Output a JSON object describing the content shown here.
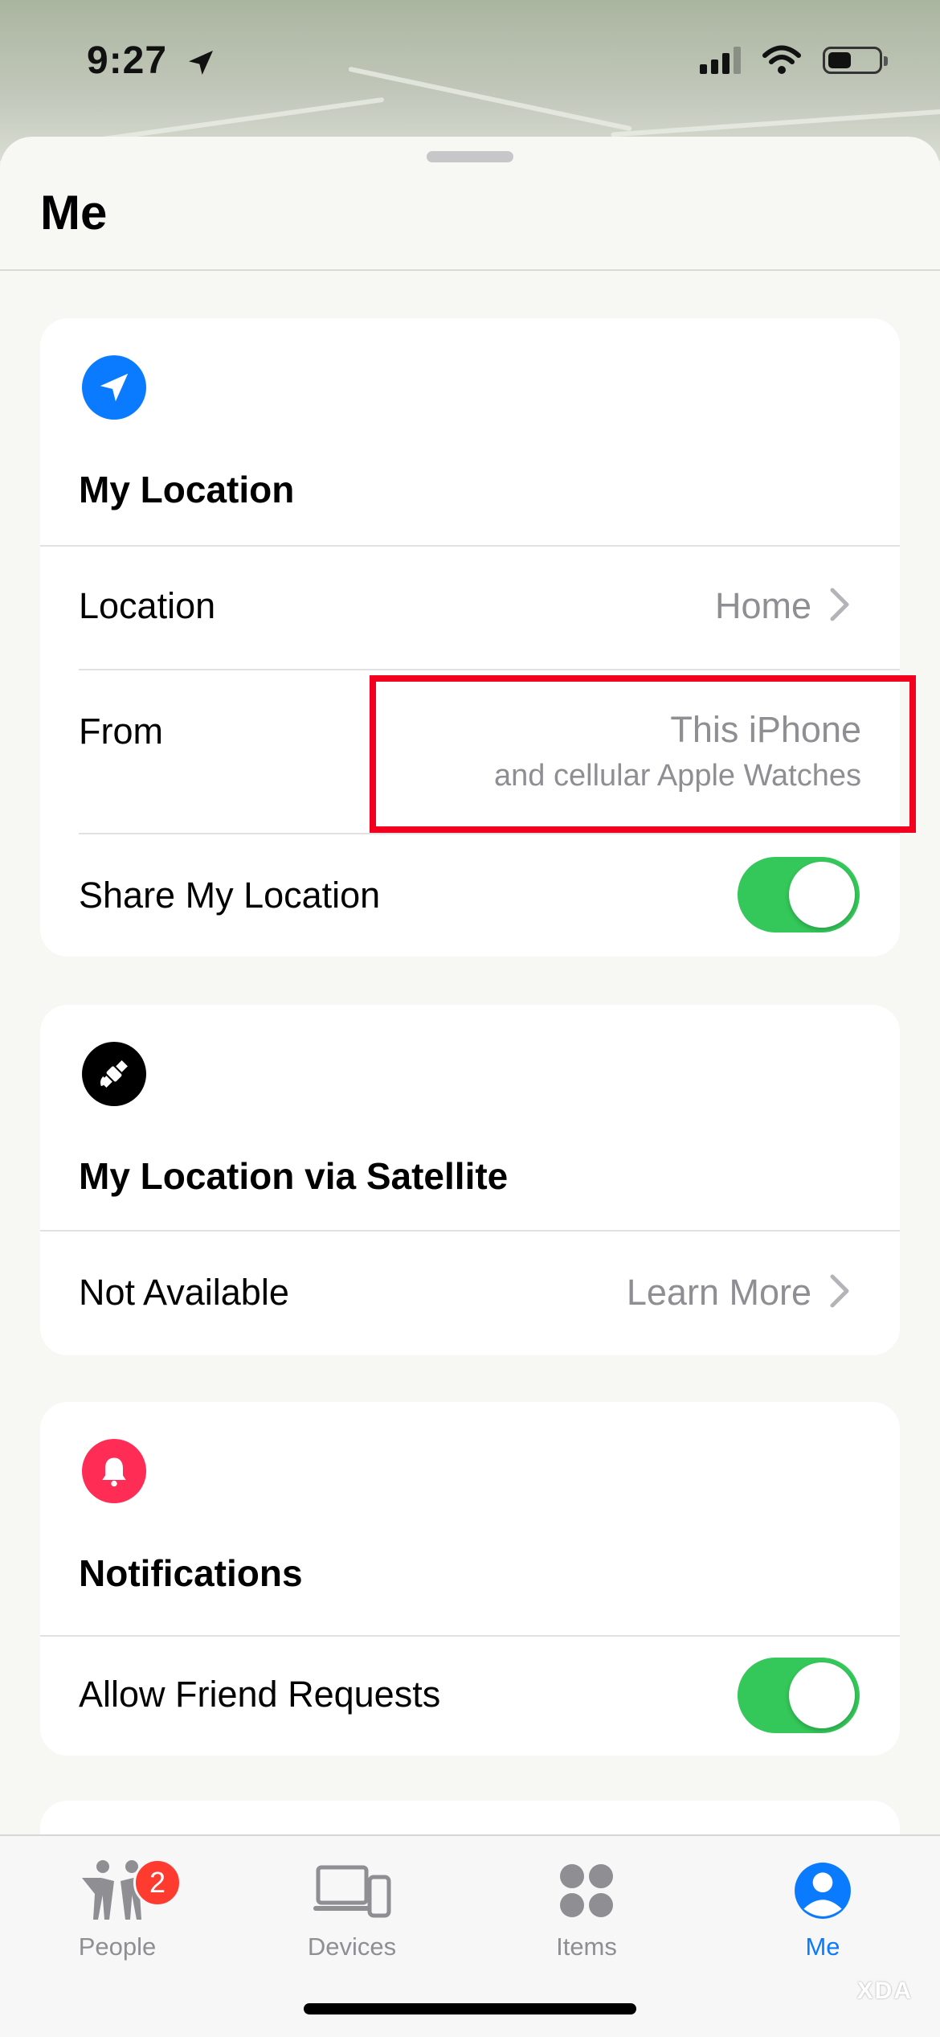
{
  "status": {
    "time": "9:27"
  },
  "sheet": {
    "title": "Me"
  },
  "my_location": {
    "heading": "My Location",
    "location_label": "Location",
    "location_value": "Home",
    "from_label": "From",
    "from_value": "This iPhone",
    "from_sub": "and cellular Apple Watches",
    "share_label": "Share My Location",
    "share_enabled": true
  },
  "satellite": {
    "heading": "My Location via Satellite",
    "status_label": "Not Available",
    "learn_more": "Learn More"
  },
  "notifications": {
    "heading": "Notifications",
    "friend_requests_label": "Allow Friend Requests",
    "friend_requests_enabled": true
  },
  "tabs": [
    {
      "label": "People",
      "icon": "people-icon",
      "badge": "2"
    },
    {
      "label": "Devices",
      "icon": "devices-icon"
    },
    {
      "label": "Items",
      "icon": "items-icon"
    },
    {
      "label": "Me",
      "icon": "me-icon",
      "active": true
    }
  ],
  "watermark": "XDA",
  "colors": {
    "accent": "#0a7aff",
    "toggle_on": "#34c759",
    "bell": "#ff2d55",
    "highlight": "#f2001d"
  }
}
